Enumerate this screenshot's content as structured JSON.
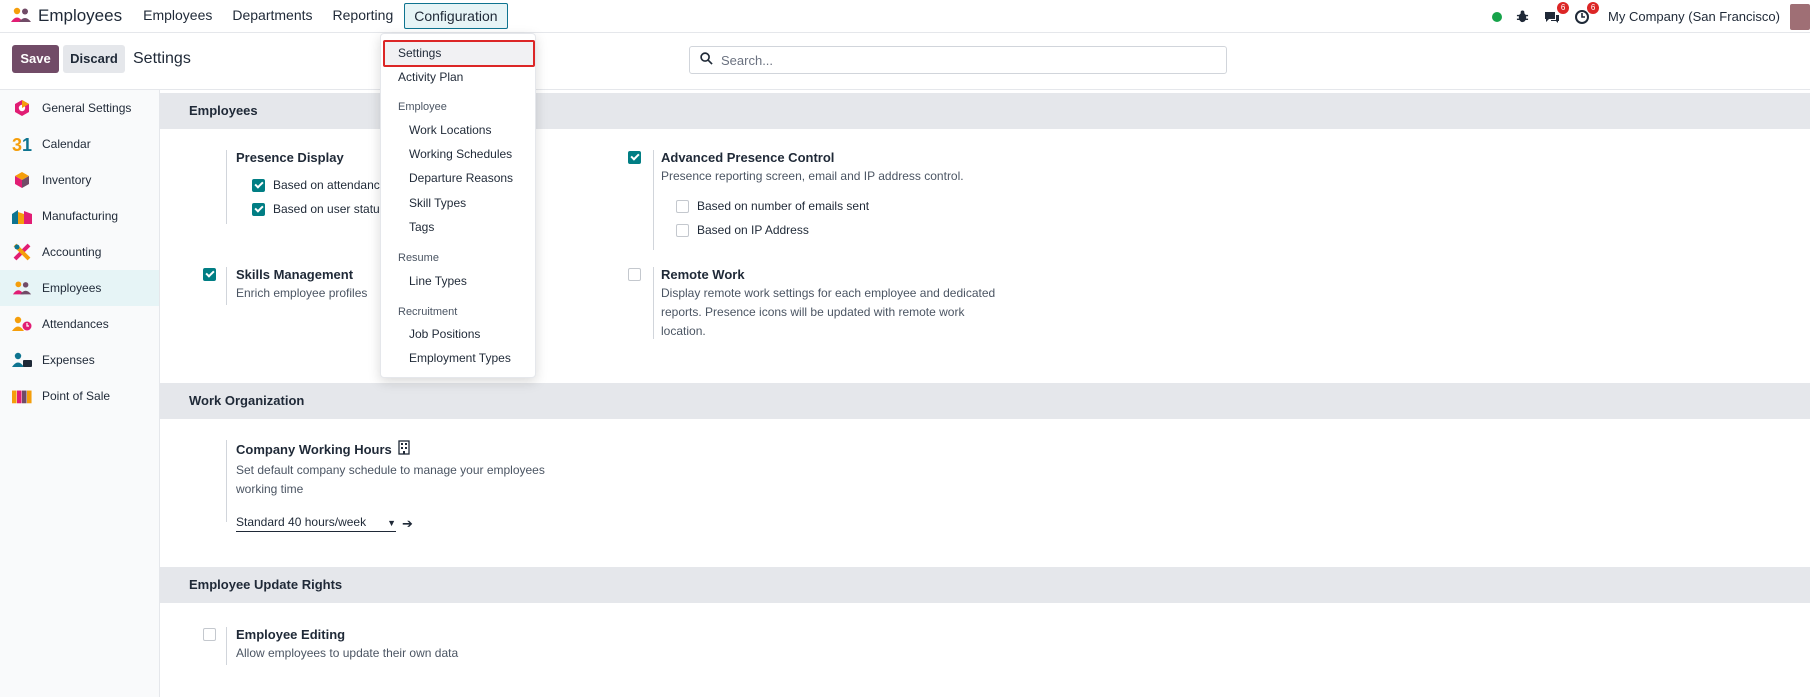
{
  "navbar": {
    "app_name": "Employees",
    "menu": [
      "Employees",
      "Departments",
      "Reporting",
      "Configuration"
    ],
    "chat_badge": "6",
    "activity_badge": "6",
    "company": "My Company (San Francisco)"
  },
  "control": {
    "save_label": "Save",
    "discard_label": "Discard",
    "title": "Settings",
    "search_placeholder": "Search..."
  },
  "sidebar": {
    "items": [
      "General Settings",
      "Calendar",
      "Inventory",
      "Manufacturing",
      "Accounting",
      "Employees",
      "Attendances",
      "Expenses",
      "Point of Sale"
    ],
    "active": "Employees"
  },
  "sections": {
    "employees": "Employees",
    "work_org": "Work Organization",
    "update_rights": "Employee Update Rights"
  },
  "settings": {
    "presence_display": {
      "title": "Presence Display",
      "options": [
        "Based on attendanc",
        "Based on user statu"
      ]
    },
    "advanced_presence": {
      "title": "Advanced Presence Control",
      "desc": "Presence reporting screen, email and IP address control.",
      "options": [
        "Based on number of emails sent",
        "Based on IP Address"
      ],
      "checked": true
    },
    "skills": {
      "title": "Skills Management",
      "desc": "Enrich employee profiles",
      "checked": true
    },
    "remote": {
      "title": "Remote Work",
      "desc_lines": [
        "Display remote work settings for each employee and dedicated",
        "reports. Presence icons will be updated with remote work",
        "location."
      ],
      "checked": false
    },
    "working_hours": {
      "title": "Company Working Hours",
      "desc_lines": [
        "Set default company schedule to manage your employees",
        "working time"
      ],
      "value": "Standard 40 hours/week"
    },
    "editing": {
      "title": "Employee Editing",
      "desc": "Allow employees to update their own data",
      "checked": false
    }
  },
  "dropdown": {
    "settings": "Settings",
    "activity_plan": "Activity Plan",
    "employee_head": "Employee",
    "employee_items": [
      "Work Locations",
      "Working Schedules",
      "Departure Reasons",
      "Skill Types",
      "Tags"
    ],
    "resume_head": "Resume",
    "resume_items": [
      "Line Types"
    ],
    "recruitment_head": "Recruitment",
    "recruitment_items": [
      "Job Positions",
      "Employment Types"
    ]
  }
}
